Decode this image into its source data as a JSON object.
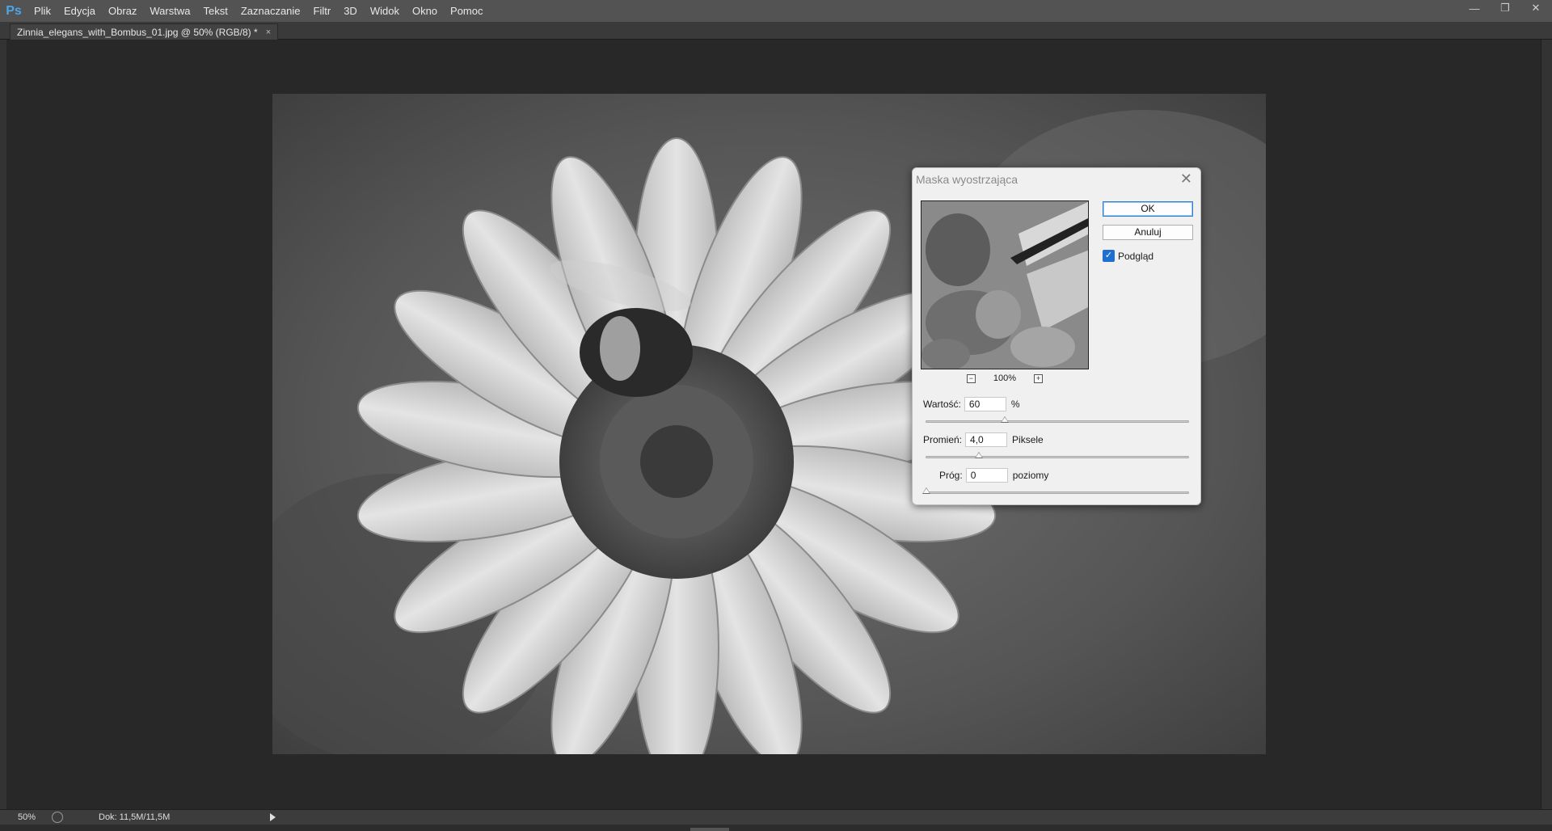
{
  "app": {
    "logo": "Ps",
    "menu": [
      "Plik",
      "Edycja",
      "Obraz",
      "Warstwa",
      "Tekst",
      "Zaznaczanie",
      "Filtr",
      "3D",
      "Widok",
      "Okno",
      "Pomoc"
    ],
    "window_controls": [
      "minimize-icon",
      "restore-icon",
      "close-icon"
    ]
  },
  "document": {
    "tab_title": "Zinnia_elegans_with_Bombus_01.jpg @ 50% (RGB/8) *",
    "tab_close": "×"
  },
  "status": {
    "zoom": "50%",
    "doc_info": "Dok: 11,5M/11,5M"
  },
  "dialog": {
    "title": "Maska wyostrzająca",
    "close_glyph": "✕",
    "ok_label": "OK",
    "cancel_label": "Anuluj",
    "preview_label": "Podgląd",
    "preview_checked": true,
    "preview_zoom": "100%",
    "zoom_out_glyph": "−",
    "zoom_in_glyph": "+",
    "amount": {
      "label": "Wartość:",
      "value": "60",
      "unit": "%",
      "slider_fraction": 0.3
    },
    "radius": {
      "label": "Promień:",
      "value": "4,0",
      "unit": "Piksele",
      "slider_fraction": 0.2
    },
    "threshold": {
      "label": "Próg:",
      "value": "0",
      "unit": "poziomy",
      "slider_fraction": 0.0
    }
  }
}
